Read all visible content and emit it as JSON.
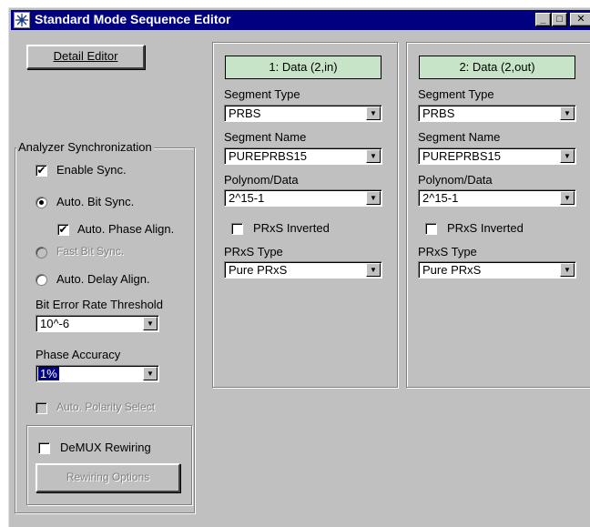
{
  "window": {
    "title": "Standard Mode Sequence Editor"
  },
  "titlebar_buttons": {
    "minimize": "_",
    "maximize": "□",
    "close": "✕"
  },
  "left": {
    "detail_editor_label": "Detail Editor",
    "analyzer_sync": {
      "group_label": "Analyzer Synchronization",
      "enable_sync": {
        "label": "Enable Sync.",
        "checked": true
      },
      "auto_bit_sync": {
        "label": "Auto. Bit Sync.",
        "selected": true
      },
      "auto_phase_align": {
        "label": "Auto. Phase Align.",
        "checked": true
      },
      "fast_bit_sync": {
        "label": "Fast Bit Sync.",
        "enabled": false
      },
      "auto_delay_align": {
        "label": "Auto. Delay Align.",
        "selected": false
      },
      "ber_threshold": {
        "label": "Bit Error Rate Threshold",
        "value": "10^-6"
      },
      "phase_accuracy": {
        "label": "Phase Accuracy",
        "value": "1%"
      },
      "auto_polarity": {
        "label": "Auto. Polarity Select",
        "enabled": false
      },
      "demux_rewiring": {
        "label": "DeMUX Rewiring",
        "checked": false
      },
      "rewiring_options_label": "Rewiring Options"
    }
  },
  "segments": [
    {
      "header": "1: Data  (2,in)",
      "segment_type_label": "Segment Type",
      "segment_type": "PRBS",
      "segment_name_label": "Segment Name",
      "segment_name": "PUREPRBS15",
      "polynom_label": "Polynom/Data",
      "polynom": "2^15-1",
      "inverted_label": "PRxS Inverted",
      "inverted": false,
      "prxs_type_label": "PRxS Type",
      "prxs_type": "Pure PRxS"
    },
    {
      "header": "2: Data  (2,out)",
      "segment_type_label": "Segment Type",
      "segment_type": "PRBS",
      "segment_name_label": "Segment Name",
      "segment_name": "PUREPRBS15",
      "polynom_label": "Polynom/Data",
      "polynom": "2^15-1",
      "inverted_label": "PRxS Inverted",
      "inverted": false,
      "prxs_type_label": "PRxS Type",
      "prxs_type": "Pure PRxS"
    }
  ]
}
